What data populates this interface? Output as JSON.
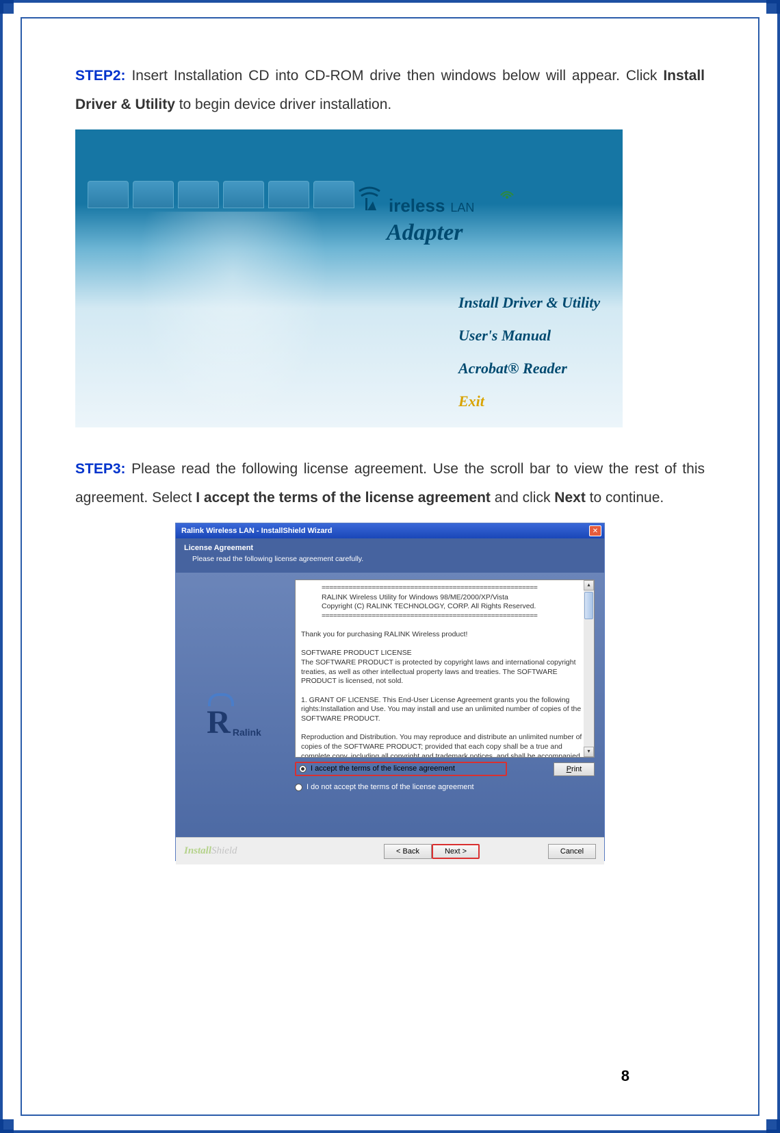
{
  "steps": {
    "step2": {
      "label": "STEP2:",
      "text_before": " Insert Installation CD into CD-ROM drive then windows below will appear. Click ",
      "bold": "Install Driver & Utility",
      "text_after": " to begin device driver installation."
    },
    "step3": {
      "label": "STEP3:",
      "text_a": " Please read the following license agreement. Use the scroll bar to view the rest of this agreement. Select ",
      "bold1": "I accept the terms of the license agreement",
      "mid": " and click ",
      "bold2": "Next",
      "text_b": " to continue."
    }
  },
  "cd_menu": {
    "brand_text": "ireless",
    "brand_lan": "LAN",
    "adapter": "Adapter",
    "items": [
      "Install Driver & Utility",
      "User's  Manual",
      "Acrobat® Reader",
      "Exit"
    ]
  },
  "wizard": {
    "title": "Ralink Wireless LAN - InstallShield Wizard",
    "header_title": "License Agreement",
    "header_sub": "Please read the following license agreement carefully.",
    "ralink_name": "Ralink",
    "license": {
      "hr": "========================================================",
      "line1": "RALINK Wireless Utility for Windows 98/ME/2000/XP/Vista",
      "line2": "Copyright (C) RALINK TECHNOLOGY, CORP. All Rights Reserved.",
      "thanks": "Thank you for purchasing RALINK Wireless product!",
      "spl_caption": "SOFTWARE PRODUCT LICENSE",
      "spl_body": "The SOFTWARE PRODUCT is protected by copyright laws and international copyright treaties, as well as other intellectual property laws and treaties. The SOFTWARE PRODUCT is licensed, not sold.",
      "grant_title": "1. GRANT OF LICENSE. This End-User License Agreement grants you the following rights:Installation and Use. You may install and use an unlimited number of copies of the SOFTWARE PRODUCT.",
      "repro": "Reproduction and Distribution. You may reproduce and distribute an unlimited number of copies of the SOFTWARE PRODUCT; provided that each copy shall be a true and complete copy, including all copyright and trademark notices, and shall be accompanied by a copy of this EULA. Copies of the SOFTWARE PRODUCT may be distributed as a standalone product or included with your own product."
    },
    "radios": {
      "accept": "I accept the terms of the license agreement",
      "reject": "I do not accept the terms of the license agreement"
    },
    "buttons": {
      "print": "Print",
      "back": "< Back",
      "next": "Next >",
      "cancel": "Cancel"
    },
    "footer_brand": "InstallShield"
  },
  "page_number": "8"
}
